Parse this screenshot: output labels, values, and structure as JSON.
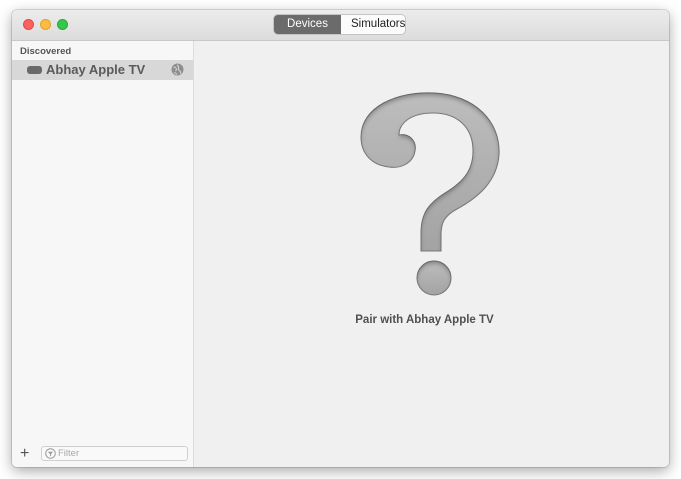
{
  "window": {
    "tabs": [
      {
        "label": "Devices",
        "active": true
      },
      {
        "label": "Simulators",
        "active": false
      }
    ]
  },
  "sidebar": {
    "section_header": "Discovered",
    "devices": [
      {
        "name": "Abhay Apple TV",
        "icon": "appletv-icon",
        "status_icon": "network-icon"
      }
    ],
    "filter_placeholder": "Filter",
    "add_icon": "plus-icon"
  },
  "main": {
    "illustration": "question-mark-icon",
    "pair_label": "Pair with Abhay Apple TV"
  },
  "colors": {
    "close": "#fc605c",
    "minimize": "#fdbc40",
    "zoom": "#34c84a",
    "segment_active": "#6b6b6b"
  }
}
